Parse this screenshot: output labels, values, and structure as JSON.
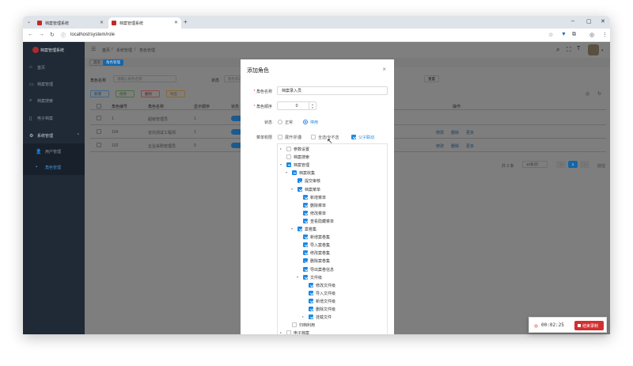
{
  "browser": {
    "tabs": [
      {
        "title": "档案管理系统",
        "active": false
      },
      {
        "title": "档案管理系统",
        "active": true
      }
    ],
    "new_tab": "+",
    "tab_dropdown": "⌄",
    "url": "localhost/system/role",
    "window_controls": [
      "–",
      "▢",
      "✕"
    ]
  },
  "app": {
    "title": "档案管理系统",
    "sidebar": {
      "items": [
        {
          "label": "首页",
          "icon": "home-icon"
        },
        {
          "label": "档案管理",
          "icon": "folder-icon"
        },
        {
          "label": "档案搜索",
          "icon": "search-icon"
        },
        {
          "label": "电子档案",
          "icon": "file-icon"
        },
        {
          "label": "系统管理",
          "icon": "gear-icon"
        },
        {
          "label": "用户管理",
          "icon": "user-icon"
        },
        {
          "label": "角色管理",
          "icon": "role-icon"
        }
      ]
    },
    "breadcrumb": [
      "首页",
      "系统管理",
      "角色管理"
    ],
    "tags": [
      "首页",
      "角色管理"
    ],
    "search": {
      "role_name_label": "角色名称",
      "role_name_placeholder": "请输入角色名称",
      "status_label": "状态",
      "status_placeholder": "角色状态",
      "reset": "重置"
    },
    "toolbar": [
      "新增",
      "修改",
      "删除",
      "导出"
    ],
    "table": {
      "headers": [
        "角色编号",
        "角色名称",
        "显示顺序",
        "状态",
        "操作"
      ],
      "rows": [
        {
          "id": "1",
          "name": "超级管理员",
          "order": "1"
        },
        {
          "id": "104",
          "name": "省均测试工程师",
          "order": "1",
          "actions": [
            "修改",
            "删除",
            "更多"
          ]
        },
        {
          "id": "102",
          "name": "企业采购管理员",
          "order": "5",
          "actions": [
            "修改",
            "删除",
            "更多"
          ]
        }
      ]
    },
    "pagination": {
      "total": "共 3 条",
      "page_size": "10条/页",
      "current": "1",
      "goto_label": "前往",
      "goto_value": "1",
      "goto_unit": "页"
    }
  },
  "modal": {
    "title": "添加角色",
    "close": "×",
    "fields": {
      "name_label": "角色名称",
      "name_value": "档案录入员",
      "order_label": "角色顺序",
      "order_value": "0",
      "status_label": "状态",
      "status_options": [
        {
          "label": "正常",
          "selected": false
        },
        {
          "label": "停用",
          "selected": true
        }
      ],
      "perm_label": "菜单权限",
      "perm_options": [
        {
          "label": "展开/折叠",
          "checked": false
        },
        {
          "label": "全选/全不选",
          "checked": false
        },
        {
          "label": "父子联动",
          "checked": true
        }
      ]
    },
    "tree": [
      {
        "label": "参数设置",
        "level": 0,
        "checked": "none",
        "caret": "▸"
      },
      {
        "label": "档案搜索",
        "level": 0,
        "checked": "none",
        "caret": ""
      },
      {
        "label": "档案管理",
        "level": 0,
        "checked": "partial",
        "caret": "▾"
      },
      {
        "label": "档案收集",
        "level": 1,
        "checked": "partial",
        "caret": "▾"
      },
      {
        "label": "提交审核",
        "level": 2,
        "checked": "on",
        "caret": ""
      },
      {
        "label": "档案菜单",
        "level": 2,
        "checked": "on",
        "caret": "▾"
      },
      {
        "label": "新增菜单",
        "level": 3,
        "checked": "on",
        "caret": ""
      },
      {
        "label": "删除菜单",
        "level": 3,
        "checked": "on",
        "caret": ""
      },
      {
        "label": "修改菜单",
        "level": 3,
        "checked": "on",
        "caret": ""
      },
      {
        "label": "查看隐藏菜单",
        "level": 3,
        "checked": "on",
        "caret": ""
      },
      {
        "label": "案卷集",
        "level": 2,
        "checked": "on",
        "caret": "▾"
      },
      {
        "label": "新增案卷集",
        "level": 3,
        "checked": "on",
        "caret": ""
      },
      {
        "label": "导入案卷集",
        "level": 3,
        "checked": "on",
        "caret": ""
      },
      {
        "label": "修改案卷集",
        "level": 3,
        "checked": "on",
        "caret": ""
      },
      {
        "label": "删除案卷集",
        "level": 3,
        "checked": "on",
        "caret": ""
      },
      {
        "label": "导出案卷信息",
        "level": 3,
        "checked": "on",
        "caret": ""
      },
      {
        "label": "文件级",
        "level": 3,
        "checked": "on",
        "caret": "▾"
      },
      {
        "label": "修改文件级",
        "level": 4,
        "checked": "on",
        "caret": ""
      },
      {
        "label": "导入文件级",
        "level": 4,
        "checked": "on",
        "caret": ""
      },
      {
        "label": "新增文件级",
        "level": 4,
        "checked": "on",
        "caret": ""
      },
      {
        "label": "删除文件级",
        "level": 4,
        "checked": "on",
        "caret": ""
      },
      {
        "label": "挂载文件",
        "level": 4,
        "checked": "on",
        "caret": "▸"
      },
      {
        "label": "归档利用",
        "level": 1,
        "checked": "none",
        "caret": ""
      },
      {
        "label": "电子档案",
        "level": 0,
        "checked": "none",
        "caret": "▸"
      }
    ]
  },
  "recorder": {
    "time": "00:02:25",
    "stop_label": "结束录制"
  },
  "colors": {
    "accent": "#1e88e5",
    "sidebar_bg": "#1f2a36",
    "record_red": "#d32f2f"
  }
}
